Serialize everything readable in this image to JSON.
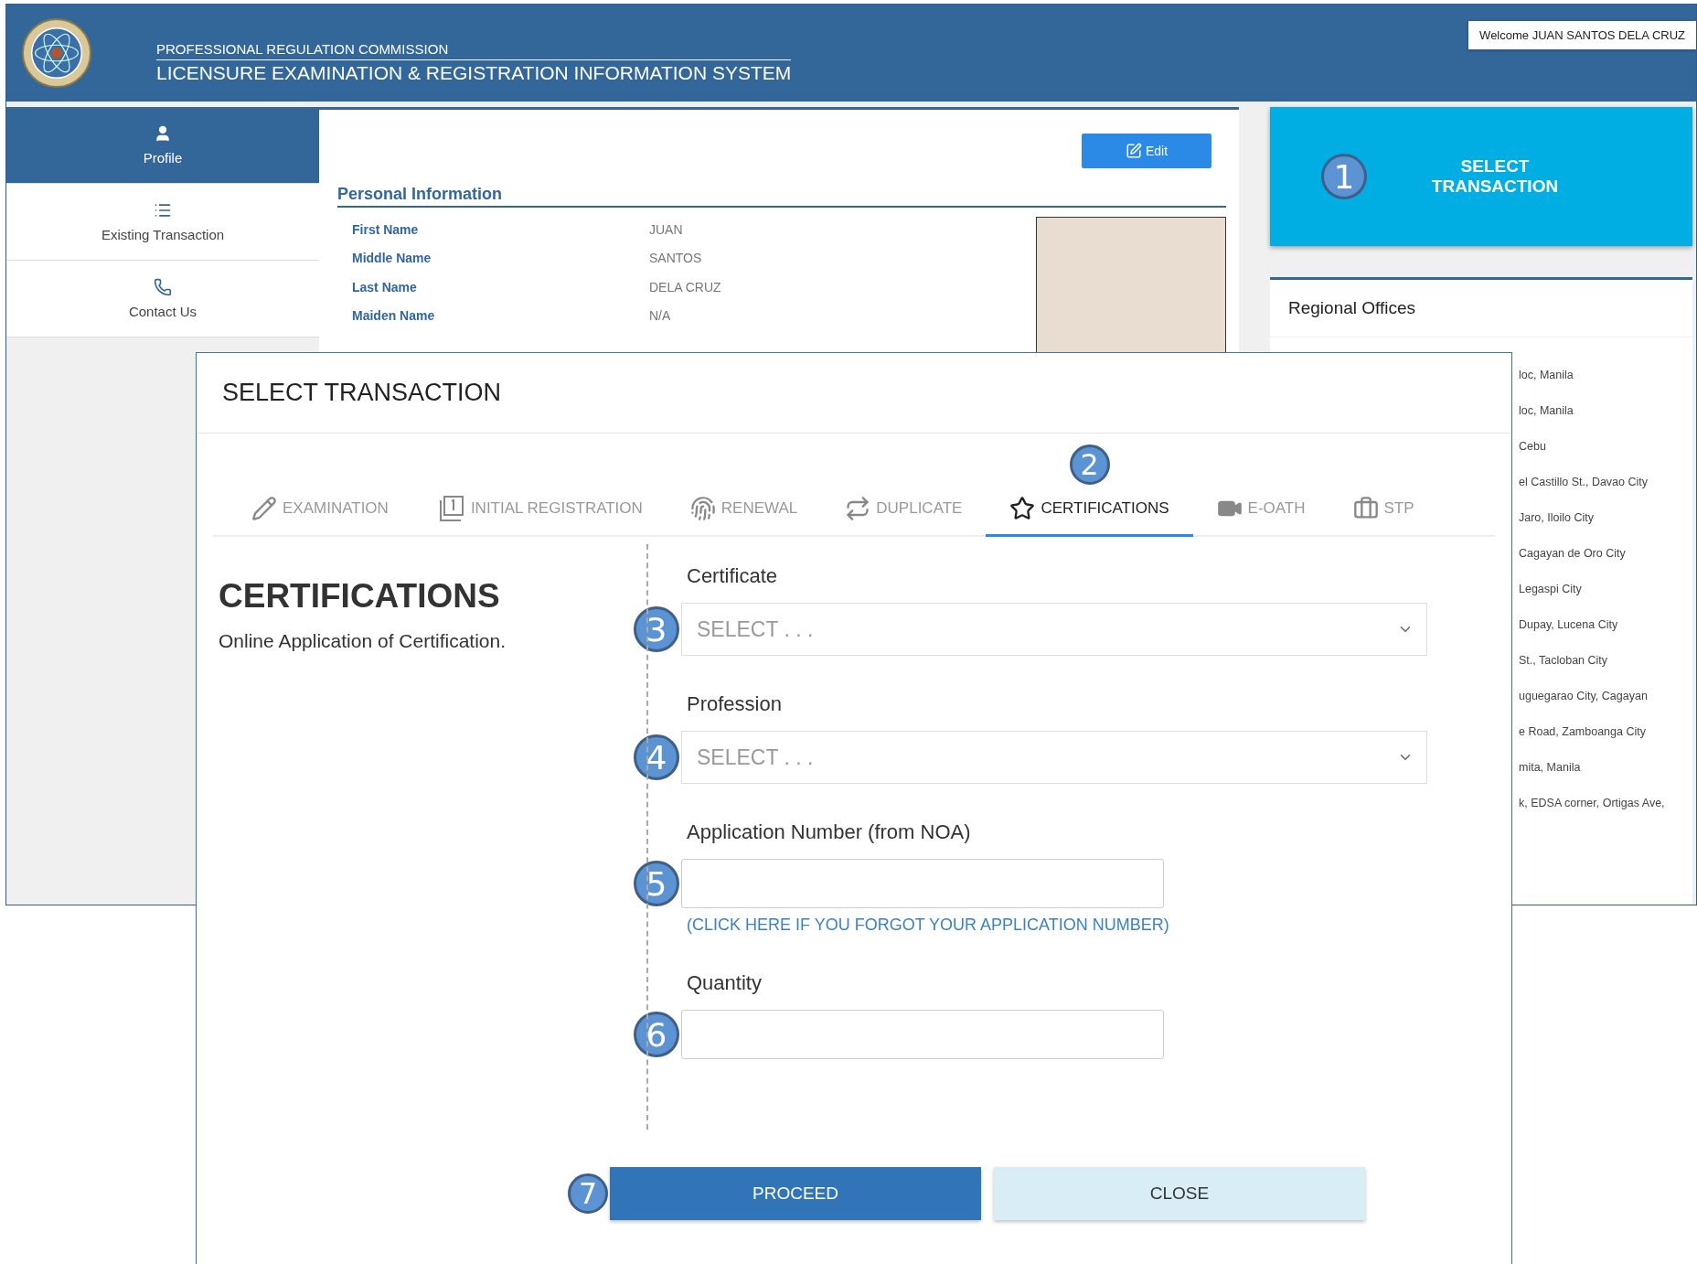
{
  "header": {
    "org": "PROFESSIONAL REGULATION COMMISSION",
    "system": "LICENSURE EXAMINATION & REGISTRATION INFORMATION SYSTEM",
    "welcome": "Welcome JUAN SANTOS DELA CRUZ"
  },
  "sidebar": {
    "items": [
      {
        "label": "Profile",
        "selected": true
      },
      {
        "label": "Existing Transaction",
        "selected": false
      },
      {
        "label": "Contact Us",
        "selected": false
      }
    ]
  },
  "profile": {
    "edit_button": "Edit",
    "section_title": "Personal Information",
    "fields": [
      {
        "label": "First Name",
        "value": "JUAN"
      },
      {
        "label": "Middle Name",
        "value": "SANTOS"
      },
      {
        "label": "Last Name",
        "value": "DELA CRUZ"
      },
      {
        "label": "Maiden Name",
        "value": "N/A"
      }
    ]
  },
  "select_tile": {
    "label": "SELECT TRANSACTION",
    "marker": "1"
  },
  "regional_offices": {
    "title": "Regional Offices",
    "items": [
      "loc, Manila",
      "loc, Manila",
      "Cebu",
      "el Castillo St., Davao City",
      "Jaro, Iloilo City",
      "Cagayan de Oro City",
      "Legaspi City",
      "Dupay, Lucena City",
      "St., Tacloban City",
      "uguegarao City, Cagayan",
      "e Road, Zamboanga City",
      "mita, Manila",
      "k, EDSA corner, Ortigas Ave,"
    ]
  },
  "modal": {
    "title": "SELECT TRANSACTION",
    "tab_marker": "2",
    "tabs": [
      {
        "label": "EXAMINATION",
        "selected": false
      },
      {
        "label": "INITIAL REGISTRATION",
        "selected": false
      },
      {
        "label": "RENEWAL",
        "selected": false
      },
      {
        "label": "DUPLICATE",
        "selected": false
      },
      {
        "label": "CERTIFICATIONS",
        "selected": true
      },
      {
        "label": "E-OATH",
        "selected": false
      },
      {
        "label": "STP",
        "selected": false
      }
    ],
    "section_title": "CERTIFICATIONS",
    "section_subtitle": "Online Application of Certification.",
    "fields": [
      {
        "kind": "select",
        "label": "Certificate",
        "placeholder": "SELECT . . .",
        "marker": "3"
      },
      {
        "kind": "select",
        "label": "Profession",
        "placeholder": "SELECT . . .",
        "marker": "4"
      },
      {
        "kind": "input",
        "label": "Application Number (from NOA)",
        "marker": "5",
        "link": "(CLICK HERE IF YOU FORGOT YOUR APPLICATION NUMBER)"
      },
      {
        "kind": "input",
        "label": "Quantity",
        "marker": "6"
      }
    ],
    "buttons": [
      {
        "kind": "primary",
        "label": "PROCEED",
        "marker": "7"
      },
      {
        "kind": "secondary",
        "label": "CLOSE"
      }
    ]
  }
}
